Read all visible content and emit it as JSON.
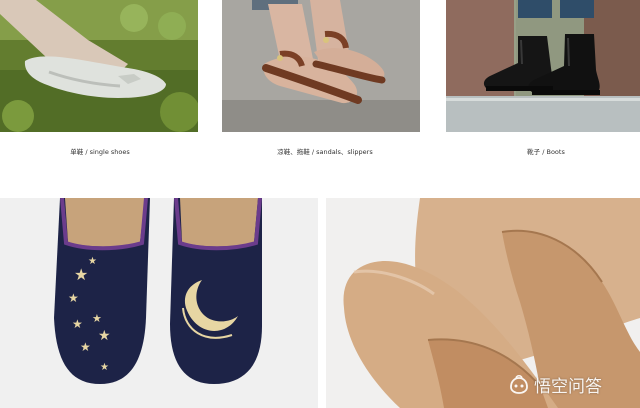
{
  "captions": {
    "single_shoes": "单鞋 / single shoes",
    "sandals_slippers": "凉鞋、拖鞋 / sandals、slippers",
    "boots": "靴子 / Boots"
  },
  "watermark": {
    "text": "悟空问答"
  },
  "colors": {
    "background": "#ffffff",
    "velvet_navy": "#1d2347",
    "embroidery_gold": "#e7d6a3",
    "nude_leather": "#d7b18d",
    "boot_black": "#151515",
    "sandal_brown": "#6f3a22"
  }
}
